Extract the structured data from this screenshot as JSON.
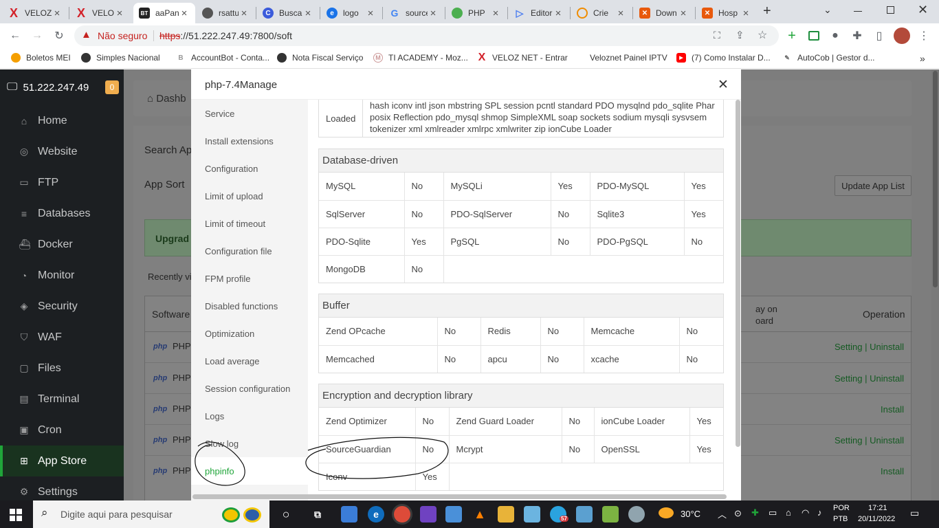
{
  "browser": {
    "tabs": [
      {
        "title": "VELOZ",
        "icon": "veloz-x-icon"
      },
      {
        "title": "VELOZ",
        "icon": "veloz-x-icon"
      },
      {
        "title": "aaPanel",
        "icon": "bt-icon"
      },
      {
        "title": "rsattu",
        "icon": "github-icon"
      },
      {
        "title": "Busca",
        "icon": "c-icon"
      },
      {
        "title": "logo",
        "icon": "e-icon"
      },
      {
        "title": "source",
        "icon": "google-icon"
      },
      {
        "title": "PHP",
        "icon": "frog-icon"
      },
      {
        "title": "Editor",
        "icon": "play-icon"
      },
      {
        "title": "Crie",
        "icon": "orange-c-icon"
      },
      {
        "title": "Down",
        "icon": "x-square-icon"
      },
      {
        "title": "Hosp",
        "icon": "x-square-icon"
      }
    ],
    "insecure_label": "Não seguro",
    "url_scheme": "https",
    "url_rest": "://51.222.247.49:7800/soft",
    "bookmarks": [
      "Boletos MEI",
      "Simples Nacional",
      "AccountBot - Conta...",
      "Nota Fiscal Serviço",
      "TI ACADEMY - Moz...",
      "VELOZ NET - Entrar",
      "Veloznet Painel IPTV",
      "(7) Como Instalar D...",
      "AutoCob | Gestor d..."
    ]
  },
  "panel": {
    "server_ip": "51.222.247.49",
    "badge": "0",
    "menu": [
      "Home",
      "Website",
      "FTP",
      "Databases",
      "Docker",
      "Monitor",
      "Security",
      "WAF",
      "Files",
      "Terminal",
      "Cron",
      "App Store",
      "Settings"
    ],
    "breadcrumb": "Dashb",
    "search_label": "Search Ap",
    "sort_label": "App Sort",
    "update_btn": "Update App List",
    "upgrade_text": "Upgrad",
    "recently_label": "Recently vi",
    "col_software": "Software",
    "col_display": "ay on\noard",
    "col_operation": "Operation",
    "rows": [
      {
        "name": "PHP-",
        "setting": "Setting",
        "sep": "|",
        "uninstall": "Uninstall",
        "install": ""
      },
      {
        "name": "PHP-",
        "setting": "Setting",
        "sep": "|",
        "uninstall": "Uninstall",
        "install": ""
      },
      {
        "name": "PHP-",
        "setting": "",
        "sep": "",
        "uninstall": "",
        "install": "Install"
      },
      {
        "name": "PHP-",
        "setting": "Setting",
        "sep": "|",
        "uninstall": "Uninstall",
        "install": ""
      },
      {
        "name": "PHP-",
        "setting": "",
        "sep": "",
        "uninstall": "",
        "install": "Install"
      }
    ],
    "php_logo": "php"
  },
  "modal": {
    "title": "php-7.4Manage",
    "nav": [
      "Service",
      "Install extensions",
      "Configuration",
      "Limit of upload",
      "Limit of timeout",
      "Configuration file",
      "FPM profile",
      "Disabled functions",
      "Optimization",
      "Load average",
      "Session configuration",
      "Logs",
      "Slow log",
      "phpinfo"
    ],
    "loaded_label": "Loaded",
    "loaded_text": "hash iconv intl json mbstring SPL session pcntl standard PDO mysqlnd pdo_sqlite Phar posix Reflection pdo_mysql shmop SimpleXML soap sockets sodium mysqli sysvsem tokenizer xml xmlreader xmlrpc xmlwriter zip ionCube Loader",
    "database": {
      "title": "Database-driven",
      "rows": [
        [
          [
            "MySQL",
            "No"
          ],
          [
            "MySQLi",
            "Yes"
          ],
          [
            "PDO-MySQL",
            "Yes"
          ]
        ],
        [
          [
            "SqlServer",
            "No"
          ],
          [
            "PDO-SqlServer",
            "No"
          ],
          [
            "Sqlite3",
            "Yes"
          ]
        ],
        [
          [
            "PDO-Sqlite",
            "Yes"
          ],
          [
            "PgSQL",
            "No"
          ],
          [
            "PDO-PgSQL",
            "No"
          ]
        ],
        [
          [
            "MongoDB",
            "No"
          ]
        ]
      ]
    },
    "buffer": {
      "title": "Buffer",
      "rows": [
        [
          [
            "Zend OPcache",
            "No"
          ],
          [
            "Redis",
            "No"
          ],
          [
            "Memcache",
            "No"
          ]
        ],
        [
          [
            "Memcached",
            "No"
          ],
          [
            "apcu",
            "No"
          ],
          [
            "xcache",
            "No"
          ]
        ]
      ]
    },
    "encryption": {
      "title": "Encryption and decryption library",
      "rows": [
        [
          [
            "Zend Optimizer",
            "No"
          ],
          [
            "Zend Guard Loader",
            "No"
          ],
          [
            "ionCube Loader",
            "Yes"
          ]
        ],
        [
          [
            "SourceGuardian",
            "No"
          ],
          [
            "Mcrypt",
            "No"
          ],
          [
            "OpenSSL",
            "Yes"
          ]
        ],
        [
          [
            "Iconv",
            "Yes"
          ]
        ]
      ]
    }
  },
  "taskbar": {
    "search_placeholder": "Digite aqui para pesquisar",
    "weather": "30°C",
    "lang1": "POR",
    "lang2": "PTB",
    "time": "17:21",
    "date": "20/11/2022",
    "telegram_badge": "57"
  },
  "colors": {
    "accent": "#20a53a",
    "no": "#ff3b30",
    "sidebar": "#1c1f22"
  }
}
